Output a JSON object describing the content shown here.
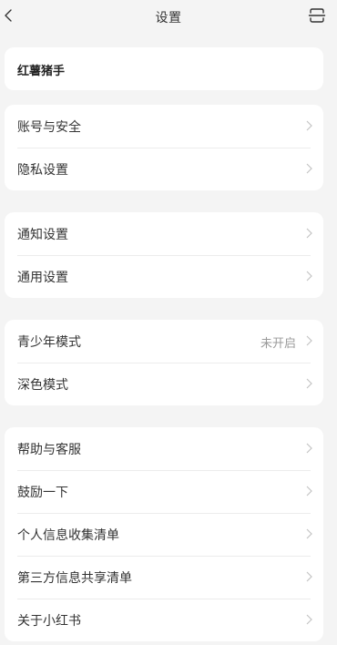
{
  "nav": {
    "title": "设置",
    "back_icon": "chevron-left-icon",
    "scan_icon": "scan-icon"
  },
  "profile": {
    "name": "红薯猪手"
  },
  "groups": [
    {
      "items": [
        {
          "label": "账号与安全"
        },
        {
          "label": "隐私设置"
        }
      ]
    },
    {
      "items": [
        {
          "label": "通知设置"
        },
        {
          "label": "通用设置"
        }
      ]
    },
    {
      "items": [
        {
          "label": "青少年模式",
          "value": "未开启"
        },
        {
          "label": "深色模式"
        }
      ]
    },
    {
      "items": [
        {
          "label": "帮助与客服"
        },
        {
          "label": "鼓励一下"
        },
        {
          "label": "个人信息收集清单"
        },
        {
          "label": "第三方信息共享清单"
        },
        {
          "label": "关于小红书"
        }
      ]
    }
  ],
  "colors": {
    "background": "#f4f4f4",
    "card": "#ffffff",
    "text": "#333333",
    "secondary_text": "#9a9a9a",
    "chevron": "#c4c4c4"
  }
}
